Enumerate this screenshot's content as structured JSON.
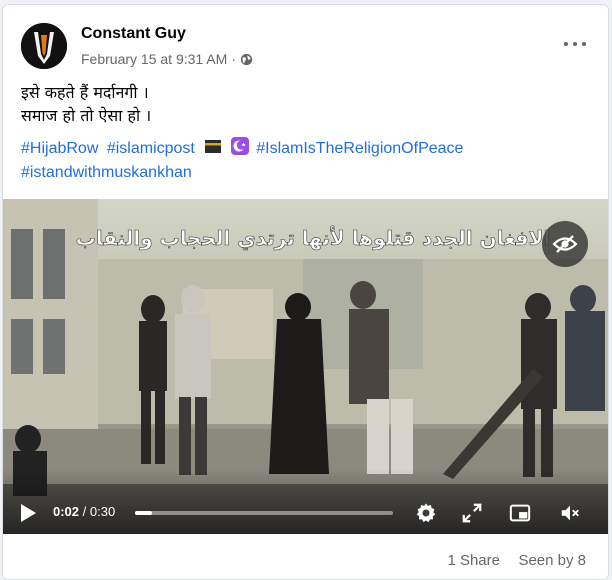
{
  "post": {
    "author": "Constant Guy",
    "timestamp": "February 15 at 9:31 AM",
    "audience_separator": "·",
    "audience_icon": "globe-icon",
    "more_icon": "more-options-icon",
    "text_lines": [
      "इसे कहते हैं मर्दानगी ।",
      "समाज हो तो ऐसा हो ।"
    ],
    "hashtags": {
      "hijabrow": "#HijabRow",
      "islamicpost": "#islamicpost",
      "islamisthereligionofpeace": "#IslamIsTheReligionOfPeace",
      "istandwithmuskankhan": "#istandwithmuskankhan"
    },
    "emojis": [
      "kaaba-emoji",
      "crescent-moon-emoji"
    ]
  },
  "video": {
    "overlay_text": "الافغان الجدد قتلوها لأنها ترتدي الحجاب والنقاب",
    "current_time": "0:02",
    "separator": " / ",
    "duration": "0:30",
    "progress_fraction": 0.067,
    "hide_icon": "eye-slash-icon",
    "play_icon": "play-icon",
    "settings_icon": "settings-icon",
    "fullscreen_icon": "fullscreen-icon",
    "miniplayer_icon": "miniplayer-icon",
    "mute_icon": "muted-speaker-icon"
  },
  "footer": {
    "shares": "1 Share",
    "seen_by": "Seen by 8"
  },
  "colors": {
    "link": "#216fdb",
    "secondary_text": "#65676b",
    "card_bg": "#ffffff",
    "page_bg": "#f0f2f5"
  }
}
